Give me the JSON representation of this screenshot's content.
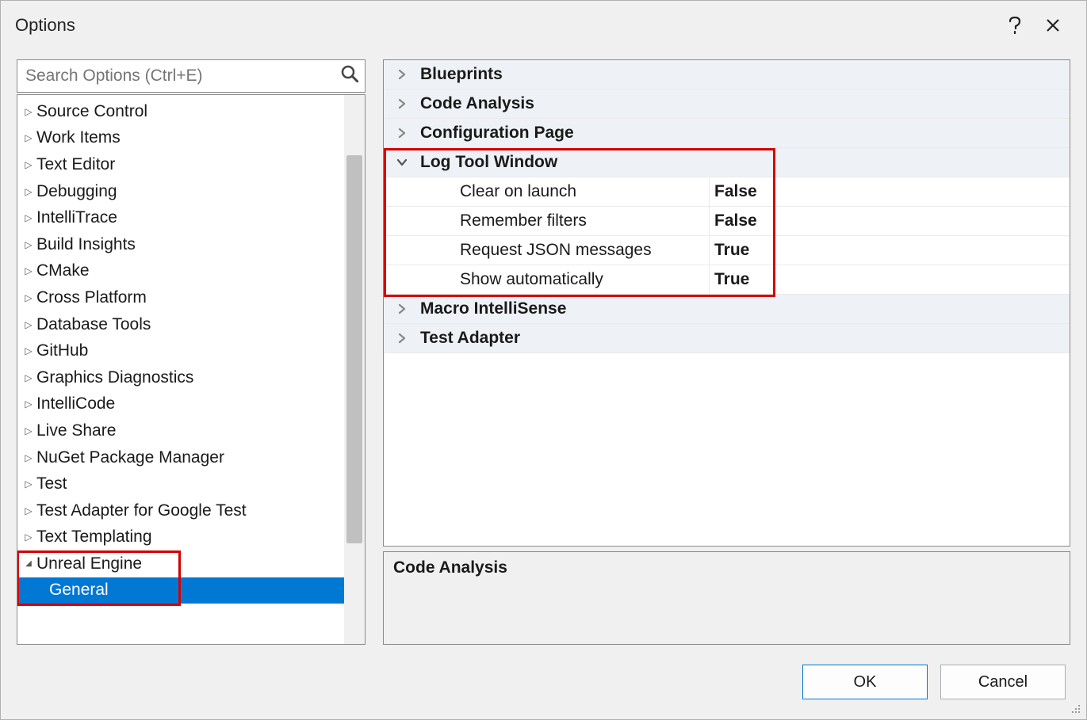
{
  "title": "Options",
  "search": {
    "placeholder": "Search Options (Ctrl+E)"
  },
  "tree": {
    "items": [
      {
        "label": "Source Control",
        "expanded": false
      },
      {
        "label": "Work Items",
        "expanded": false
      },
      {
        "label": "Text Editor",
        "expanded": false
      },
      {
        "label": "Debugging",
        "expanded": false
      },
      {
        "label": "IntelliTrace",
        "expanded": false
      },
      {
        "label": "Build Insights",
        "expanded": false
      },
      {
        "label": "CMake",
        "expanded": false
      },
      {
        "label": "Cross Platform",
        "expanded": false
      },
      {
        "label": "Database Tools",
        "expanded": false
      },
      {
        "label": "GitHub",
        "expanded": false
      },
      {
        "label": "Graphics Diagnostics",
        "expanded": false
      },
      {
        "label": "IntelliCode",
        "expanded": false
      },
      {
        "label": "Live Share",
        "expanded": false
      },
      {
        "label": "NuGet Package Manager",
        "expanded": false
      },
      {
        "label": "Test",
        "expanded": false
      },
      {
        "label": "Test Adapter for Google Test",
        "expanded": false
      },
      {
        "label": "Text Templating",
        "expanded": false
      },
      {
        "label": "Unreal Engine",
        "expanded": true,
        "children": [
          {
            "label": "General",
            "selected": true
          }
        ]
      }
    ]
  },
  "propgrid": {
    "categories": [
      {
        "label": "Blueprints",
        "expanded": false
      },
      {
        "label": "Code Analysis",
        "expanded": false
      },
      {
        "label": "Configuration Page",
        "expanded": false
      },
      {
        "label": "Log Tool Window",
        "expanded": true,
        "items": [
          {
            "label": "Clear on launch",
            "value": "False"
          },
          {
            "label": "Remember filters",
            "value": "False"
          },
          {
            "label": "Request JSON messages",
            "value": "True"
          },
          {
            "label": "Show automatically",
            "value": "True"
          }
        ]
      },
      {
        "label": "Macro IntelliSense",
        "expanded": false
      },
      {
        "label": "Test Adapter",
        "expanded": false
      }
    ],
    "description_title": "Code Analysis"
  },
  "buttons": {
    "ok": "OK",
    "cancel": "Cancel"
  }
}
